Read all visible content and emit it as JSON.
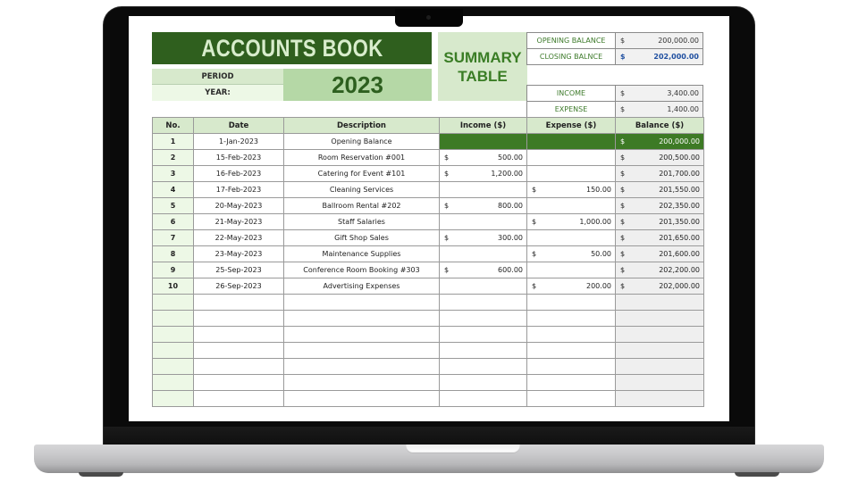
{
  "sheet": {
    "title": "ACCOUNTS BOOK",
    "period_label": "PERIOD",
    "year_label": "YEAR:",
    "year_value": "2023",
    "summary_title_line1": "SUMMARY",
    "summary_title_line2": "TABLE",
    "currency_symbol": "$",
    "summary": {
      "opening_balance_label": "OPENING BALANCE",
      "opening_balance": "200,000.00",
      "closing_balance_label": "CLOSING BALNCE",
      "closing_balance": "202,000.00",
      "income_label": "INCOME",
      "income": "3,400.00",
      "expense_label": "EXPENSE",
      "expense": "1,400.00"
    },
    "columns": [
      "No.",
      "Date",
      "Description",
      "Income ($)",
      "Expense ($)",
      "Balance ($)"
    ],
    "rows": [
      {
        "no": "1",
        "date": "1-Jan-2023",
        "description": "Opening Balance",
        "income": "",
        "expense": "",
        "balance": "200,000.00"
      },
      {
        "no": "2",
        "date": "15-Feb-2023",
        "description": "Room Reservation #001",
        "income": "500.00",
        "expense": "",
        "balance": "200,500.00"
      },
      {
        "no": "3",
        "date": "16-Feb-2023",
        "description": "Catering for Event #101",
        "income": "1,200.00",
        "expense": "",
        "balance": "201,700.00"
      },
      {
        "no": "4",
        "date": "17-Feb-2023",
        "description": "Cleaning Services",
        "income": "",
        "expense": "150.00",
        "balance": "201,550.00"
      },
      {
        "no": "5",
        "date": "20-May-2023",
        "description": "Ballroom Rental #202",
        "income": "800.00",
        "expense": "",
        "balance": "202,350.00"
      },
      {
        "no": "6",
        "date": "21-May-2023",
        "description": "Staff Salaries",
        "income": "",
        "expense": "1,000.00",
        "balance": "201,350.00"
      },
      {
        "no": "7",
        "date": "22-May-2023",
        "description": "Gift Shop Sales",
        "income": "300.00",
        "expense": "",
        "balance": "201,650.00"
      },
      {
        "no": "8",
        "date": "23-May-2023",
        "description": "Maintenance Supplies",
        "income": "",
        "expense": "50.00",
        "balance": "201,600.00"
      },
      {
        "no": "9",
        "date": "25-Sep-2023",
        "description": "Conference Room Booking #303",
        "income": "600.00",
        "expense": "",
        "balance": "202,200.00"
      },
      {
        "no": "10",
        "date": "26-Sep-2023",
        "description": "Advertising Expenses",
        "income": "",
        "expense": "200.00",
        "balance": "202,000.00"
      }
    ],
    "empty_rows": 7
  }
}
